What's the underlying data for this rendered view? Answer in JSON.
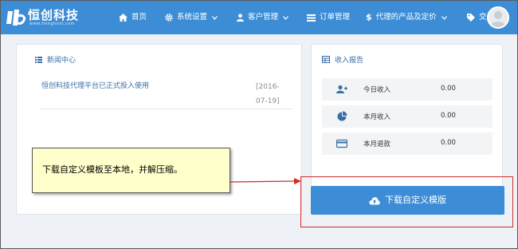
{
  "brand": {
    "title": "恒创科技",
    "subtitle": "www.henghost.com",
    "color": "#3c8dd6"
  },
  "nav": [
    {
      "label": "首页",
      "icon": "home-icon",
      "dropdown": false
    },
    {
      "label": "系统设置",
      "icon": "gear-icon",
      "dropdown": true
    },
    {
      "label": "客户管理",
      "icon": "user-icon",
      "dropdown": true
    },
    {
      "label": "订单管理",
      "icon": "list-icon",
      "dropdown": false
    },
    {
      "label": "代理的产品及定价",
      "icon": "dollar-icon",
      "dropdown": true
    },
    {
      "label": "交易",
      "icon": "tag-icon",
      "dropdown": false
    }
  ],
  "news": {
    "title": "新闻中心",
    "items": [
      {
        "text": "恒创科技代理平台已正式投入使用",
        "date_line1": "[2016-",
        "date_line2": "07-19]"
      }
    ]
  },
  "income": {
    "title": "收入报告",
    "rows": [
      {
        "label": "今日收入",
        "value": "0.00",
        "icon": "user-plus-icon"
      },
      {
        "label": "本月收入",
        "value": "0.00",
        "icon": "pie-chart-icon"
      },
      {
        "label": "本月退款",
        "value": "0.00",
        "icon": "credit-card-icon"
      }
    ]
  },
  "download_button": {
    "label": "下载自定义模版",
    "icon": "cloud-upload-icon"
  },
  "callout": {
    "text": "下载自定义模板至本地，并解压缩。"
  },
  "colors": {
    "accent": "#3c8dd6",
    "annotation": "#d42a2a",
    "callout_bg": "#ffffcc"
  }
}
